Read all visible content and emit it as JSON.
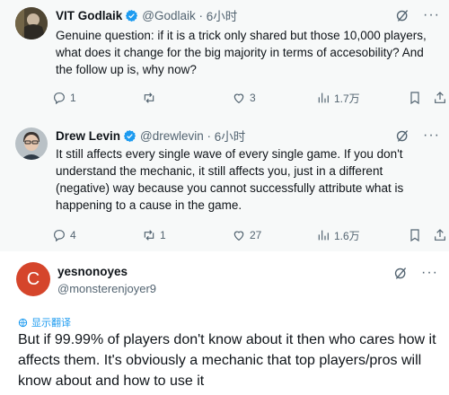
{
  "tweets": [
    {
      "name": "VIT Godlaik",
      "handle": "@Godlaik",
      "time": "6小时",
      "text": "Genuine question: if it is a trick only shared but those 10,000 players, what does it change for the big majority in terms of accesobility? And the follow up is, why now?",
      "replies": "1",
      "retweets": "",
      "likes": "3",
      "views": "1.7万"
    },
    {
      "name": "Drew Levin",
      "handle": "@drewlevin",
      "time": "6小时",
      "text": "It still affects every single wave of every single game. If you don't understand the mechanic, it still affects you, just in a different (negative) way because you cannot successfully attribute what is happening to a cause in the game.",
      "replies": "4",
      "retweets": "1",
      "likes": "27",
      "views": "1.6万"
    },
    {
      "name": "yesnonoyes",
      "handle": "@monsterenjoyer9",
      "avatar_letter": "C",
      "translate": "显示翻译",
      "text": "But if 99.99% of players don't know about it then who cares how it affects them. It's obviously a mechanic that top players/pros will know about and how to use it"
    }
  ],
  "colors": {
    "accent": "#1d9bf0",
    "avatar_bg": "#d5452b",
    "muted": "#536471"
  },
  "icons": [
    "verified-badge-icon",
    "grok-icon",
    "more-icon",
    "reply-icon",
    "retweet-icon",
    "like-icon",
    "views-icon",
    "bookmark-icon",
    "share-icon",
    "translate-icon"
  ]
}
